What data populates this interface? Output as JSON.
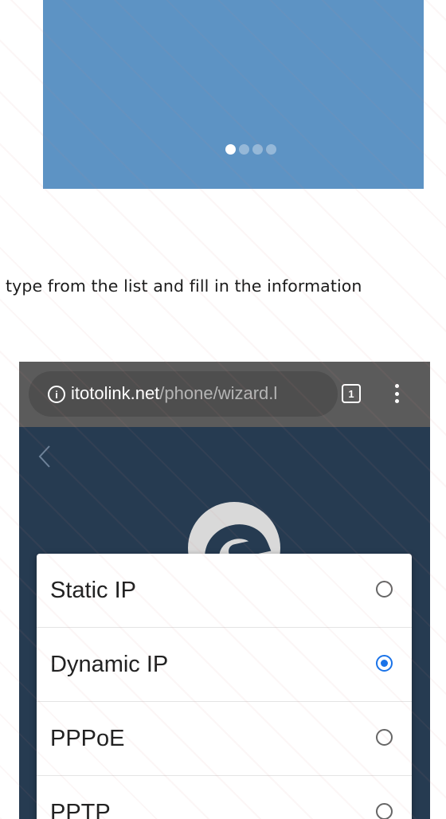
{
  "carousel": {
    "dot_count": 4,
    "active_index": 0
  },
  "instruction": {
    "text": "type from the list and fill in the information"
  },
  "phone_screen": {
    "browser": {
      "url_domain": "itotolink.net",
      "url_path": "/phone/wizard.l",
      "tab_count": "1"
    },
    "dialog": {
      "options": [
        {
          "label": "Static IP",
          "selected": false
        },
        {
          "label": "Dynamic IP",
          "selected": true
        },
        {
          "label": "PPPoE",
          "selected": false
        },
        {
          "label": "PPTP",
          "selected": false
        }
      ]
    }
  },
  "colors": {
    "carousel_bg": "#5d93c4",
    "app_bg": "#263b51",
    "browser_bar": "#5b5b5b",
    "radio_selected": "#1a73e8"
  }
}
